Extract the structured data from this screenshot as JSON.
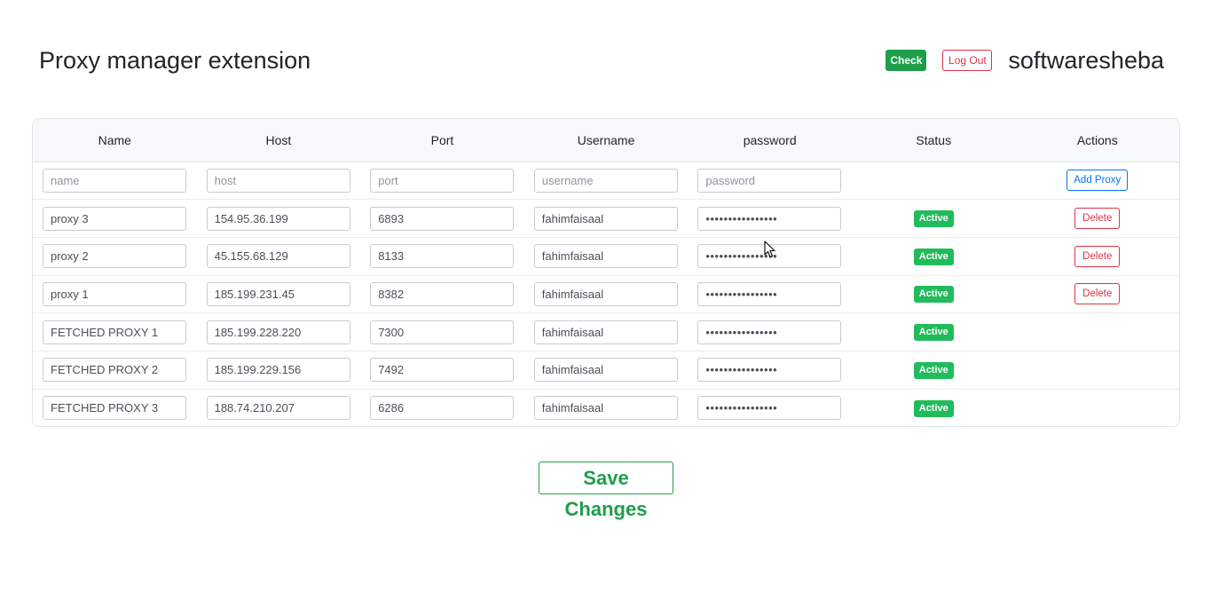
{
  "header": {
    "title": "Proxy manager extension",
    "check_label": "Check",
    "logout_label": "Log Out",
    "username": "softwaresheba"
  },
  "table": {
    "columns": [
      "Name",
      "Host",
      "Port",
      "Username",
      "password",
      "Status",
      "Actions"
    ],
    "new_row": {
      "name_placeholder": "name",
      "host_placeholder": "host",
      "port_placeholder": "port",
      "username_placeholder": "username",
      "password_placeholder": "password",
      "add_label": "Add Proxy"
    },
    "rows": [
      {
        "name": "proxy 3",
        "host": "154.95.36.199",
        "port": "6893",
        "username": "fahimfaisaal",
        "password": "••••••••••••••••",
        "status": "Active",
        "action": "Delete"
      },
      {
        "name": "proxy 2",
        "host": "45.155.68.129",
        "port": "8133",
        "username": "fahimfaisaal",
        "password": "••••••••••••••••",
        "status": "Active",
        "action": "Delete"
      },
      {
        "name": "proxy 1",
        "host": "185.199.231.45",
        "port": "8382",
        "username": "fahimfaisaal",
        "password": "••••••••••••••••",
        "status": "Active",
        "action": "Delete"
      },
      {
        "name": "FETCHED PROXY 1",
        "host": "185.199.228.220",
        "port": "7300",
        "username": "fahimfaisaal",
        "password": "••••••••••••••••",
        "status": "Active",
        "action": ""
      },
      {
        "name": "FETCHED PROXY 2",
        "host": "185.199.229.156",
        "port": "7492",
        "username": "fahimfaisaal",
        "password": "••••••••••••••••",
        "status": "Active",
        "action": ""
      },
      {
        "name": "FETCHED PROXY 3",
        "host": "188.74.210.207",
        "port": "6286",
        "username": "fahimfaisaal",
        "password": "••••••••••••••••",
        "status": "Active",
        "action": ""
      }
    ]
  },
  "save_label": "Save Changes",
  "colors": {
    "success": "#1e9e4b",
    "badge": "#22bb5b",
    "danger": "#dc3545",
    "primary": "#0d6efd"
  }
}
